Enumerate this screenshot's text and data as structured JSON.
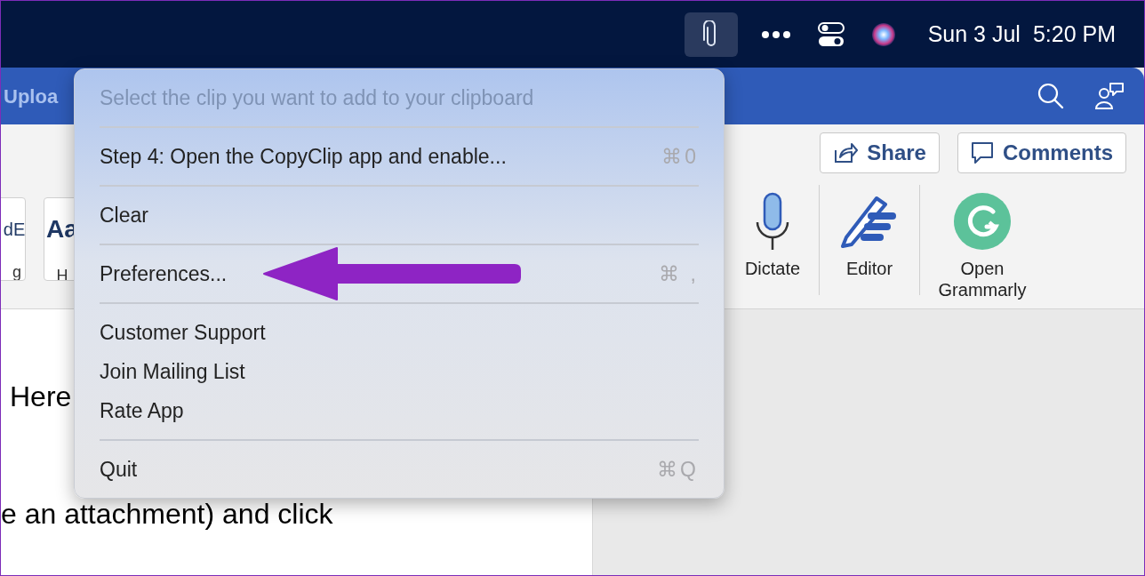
{
  "menu_bar": {
    "status_items": [
      {
        "kind": "clip",
        "active": true
      },
      {
        "kind": "more",
        "active": false
      },
      {
        "kind": "control-center",
        "active": false
      },
      {
        "kind": "siri",
        "active": false
      }
    ],
    "date": "Sun 3 Jul",
    "time": "5:20 PM"
  },
  "word": {
    "title": "Uploa",
    "ribbon_buttons": [
      {
        "kind": "share",
        "label": "Share"
      },
      {
        "kind": "comments",
        "label": "Comments"
      }
    ],
    "styles": [
      {
        "sample": "dE",
        "name": "g"
      },
      {
        "sample": "Aa",
        "name": "H"
      }
    ],
    "tools": [
      {
        "kind": "dictate",
        "label": "Dictate"
      },
      {
        "kind": "editor",
        "label": "Editor"
      },
      {
        "kind": "grammarly",
        "label": "Open Grammarly"
      }
    ],
    "document_lines": [
      "Here",
      "e an attachment) and click"
    ]
  },
  "menu": {
    "header": "Select the clip you want to add to your clipboard",
    "sections": [
      [
        {
          "label": "Step 4: Open the CopyClip app and enable...",
          "shortcut": "⌘0"
        }
      ],
      [
        {
          "label": "Clear"
        }
      ],
      [
        {
          "label": "Preferences...",
          "shortcut": "⌘ ,"
        }
      ],
      [
        {
          "label": "Customer Support"
        },
        {
          "label": "Join Mailing List"
        },
        {
          "label": "Rate App"
        }
      ],
      [
        {
          "label": "Quit",
          "shortcut": "⌘Q"
        }
      ]
    ]
  }
}
